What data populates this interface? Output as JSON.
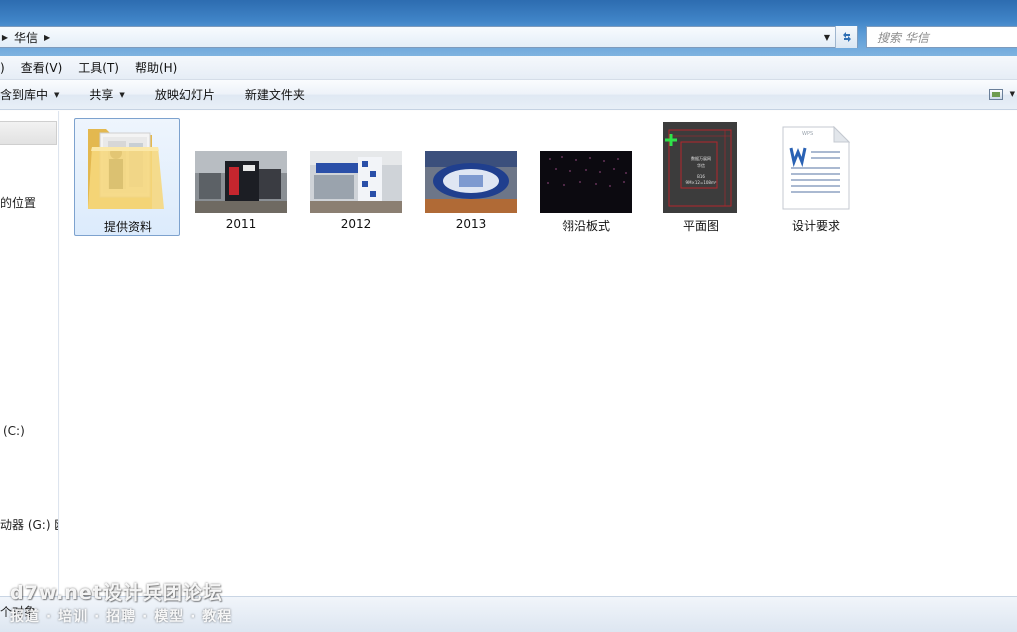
{
  "address": {
    "breadcrumb": "华信"
  },
  "search": {
    "placeholder": "搜索 华信"
  },
  "menu": [
    ")",
    "查看(V)",
    "工具(T)",
    "帮助(H)"
  ],
  "commands": {
    "include_library": "含到库中",
    "share": "共享",
    "slideshow": "放映幻灯片",
    "new_folder": "新建文件夹"
  },
  "nav": {
    "recent_places": "的位置",
    "drive_c": "(C:)",
    "drive_g": "动器 (G:) 欧"
  },
  "files": [
    {
      "name": "提供资料",
      "type": "folder",
      "selected": true
    },
    {
      "name": "2011",
      "type": "photo"
    },
    {
      "name": "2012",
      "type": "photo"
    },
    {
      "name": "2013",
      "type": "photo"
    },
    {
      "name": "翎沿板式",
      "type": "photo-dark"
    },
    {
      "name": "平面图",
      "type": "floorplan"
    },
    {
      "name": "设计要求",
      "type": "wps-document",
      "icon_label": "WPS"
    }
  ],
  "floorplan_text": {
    "title": "数据万展网",
    "subtitle": "华信",
    "line3": "B16",
    "line4": "9M×12=108m²"
  },
  "status": {
    "text": "个对象"
  },
  "watermark": {
    "line1": "d7w.net设计兵团论坛",
    "line2": "报道 · 培训 · 招聘 · 模型 · 教程"
  },
  "colors": {
    "selection_border": "#7da2ce",
    "chrome_blue": "#3f83c6"
  }
}
